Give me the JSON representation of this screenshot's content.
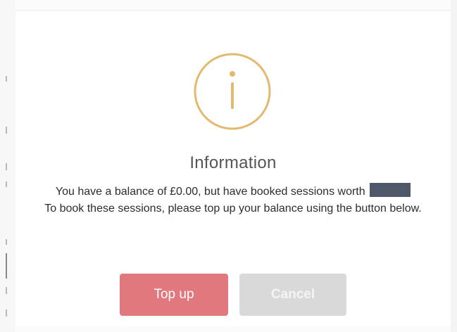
{
  "dialog": {
    "icon": "info-circle-icon",
    "title": "Information",
    "message_line1": "You have a balance of £0.00, but have booked sessions worth",
    "message_line2": "To book these sessions, please top up your balance using the button below.",
    "topup_label": "Top up",
    "cancel_label": "Cancel"
  },
  "colors": {
    "icon_gold": "#e2b96e",
    "topup_button": "#e0787d",
    "cancel_button": "#d9d9d9",
    "redaction": "#4f5868"
  }
}
